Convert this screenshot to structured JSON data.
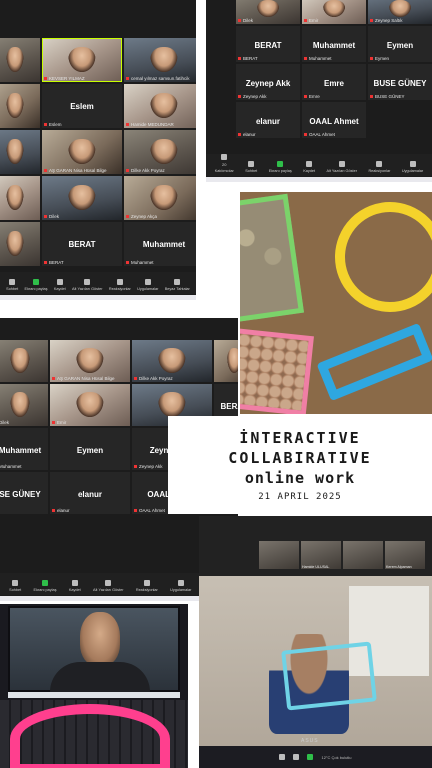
{
  "title_card": {
    "line1": "İNTERACTIVE",
    "line2": "COLLABIRATIVE",
    "line3": "online work",
    "date": "21 APRIL 2025"
  },
  "panel_a": {
    "tiles": [
      {
        "caption": "",
        "name": ""
      },
      {
        "caption": "KEVSER YILMAZ",
        "name": ""
      },
      {
        "caption": "cemal yılmaz samsun.fatihcik",
        "name": ""
      },
      {
        "caption": "",
        "name": ""
      },
      {
        "caption": "Eslem",
        "name": "Eslem"
      },
      {
        "caption": "Hamide MEDUNDAR",
        "name": ""
      },
      {
        "caption": "",
        "name": ""
      },
      {
        "caption": "AŞ GARAN Nisa Hüsal Bilge",
        "name": ""
      },
      {
        "caption": "Dilke Akk Poyraz",
        "name": ""
      },
      {
        "caption": "",
        "name": ""
      },
      {
        "caption": "Dilek",
        "name": ""
      },
      {
        "caption": "Zeynep Akça",
        "name": ""
      },
      {
        "caption": "",
        "name": ""
      },
      {
        "caption": "BERAT",
        "name": "BERAT"
      },
      {
        "caption": "Muhammet",
        "name": "Muhammet"
      }
    ],
    "toolbar": [
      "Sohbet",
      "Ekranı paylaş",
      "Kaydet",
      "Alt Yazıları Göster",
      "Reaksiyonlar",
      "Uygulamalar",
      "Beyaz Tahtalar"
    ]
  },
  "panel_b": {
    "tiles": [
      {
        "caption": "Dilek",
        "name": ""
      },
      {
        "caption": "Emir",
        "name": ""
      },
      {
        "caption": "Zeynep Saltık",
        "name": ""
      },
      {
        "caption": "BERAT",
        "name": "BERAT"
      },
      {
        "caption": "Muhammet",
        "name": "Muhammet"
      },
      {
        "caption": "Eymen",
        "name": "Eymen"
      },
      {
        "caption": "Zeynep Akk",
        "name": "Zeynep Akk"
      },
      {
        "caption": "Emre",
        "name": "Emre"
      },
      {
        "caption": "BUSE GÜNEY",
        "name": "BUSE GÜNEY"
      },
      {
        "caption": "elanur",
        "name": "elanur"
      },
      {
        "caption": "OAAL Ahmet",
        "name": "OAAL Ahmet"
      }
    ],
    "toolbar": [
      "Katılımcılar",
      "Sohbet",
      "Ekranı paylaş",
      "Kaydet",
      "Alt Yazıları Göster",
      "Reaksiyonlar",
      "Uygulamalar"
    ],
    "participants_count": "20"
  },
  "panel_c": {
    "tiles": [
      {
        "caption": "",
        "name": ""
      },
      {
        "caption": "AŞ GARAN Nisa Hüsal Bilge",
        "name": ""
      },
      {
        "caption": "Dilke Akk Poyraz",
        "name": ""
      },
      {
        "caption": "",
        "name": ""
      },
      {
        "caption": "Dilek",
        "name": ""
      },
      {
        "caption": "Emir",
        "name": ""
      },
      {
        "caption": "",
        "name": ""
      },
      {
        "caption": "BERAT",
        "name": "BERAT"
      },
      {
        "caption": "Muhammet",
        "name": "Muhammet"
      },
      {
        "caption": "",
        "name": "Eymen"
      },
      {
        "caption": "Zeynep Akk",
        "name": "Zeynep Akk"
      },
      {
        "caption": "Emre",
        "name": "Emre"
      },
      {
        "caption": "",
        "name": "SE GÜNEY"
      },
      {
        "caption": "elanur",
        "name": "elanur"
      },
      {
        "caption": "OAAL Ahmet",
        "name": "OAAL Ahmet"
      }
    ],
    "toolbar": [
      "Sohbet",
      "Ekranı paylaş",
      "Kaydet",
      "Alt Yazıları Göster",
      "Reaksiyonlar",
      "Uygulamalar",
      "Beyaz Tahtalar"
    ]
  },
  "panel_man2": {
    "thumbs": [
      "",
      "Hamide ULUSAL",
      "",
      "Kerem Alpaman"
    ],
    "weather": "12°C Çok bulutlu",
    "brand": "ASUS"
  }
}
